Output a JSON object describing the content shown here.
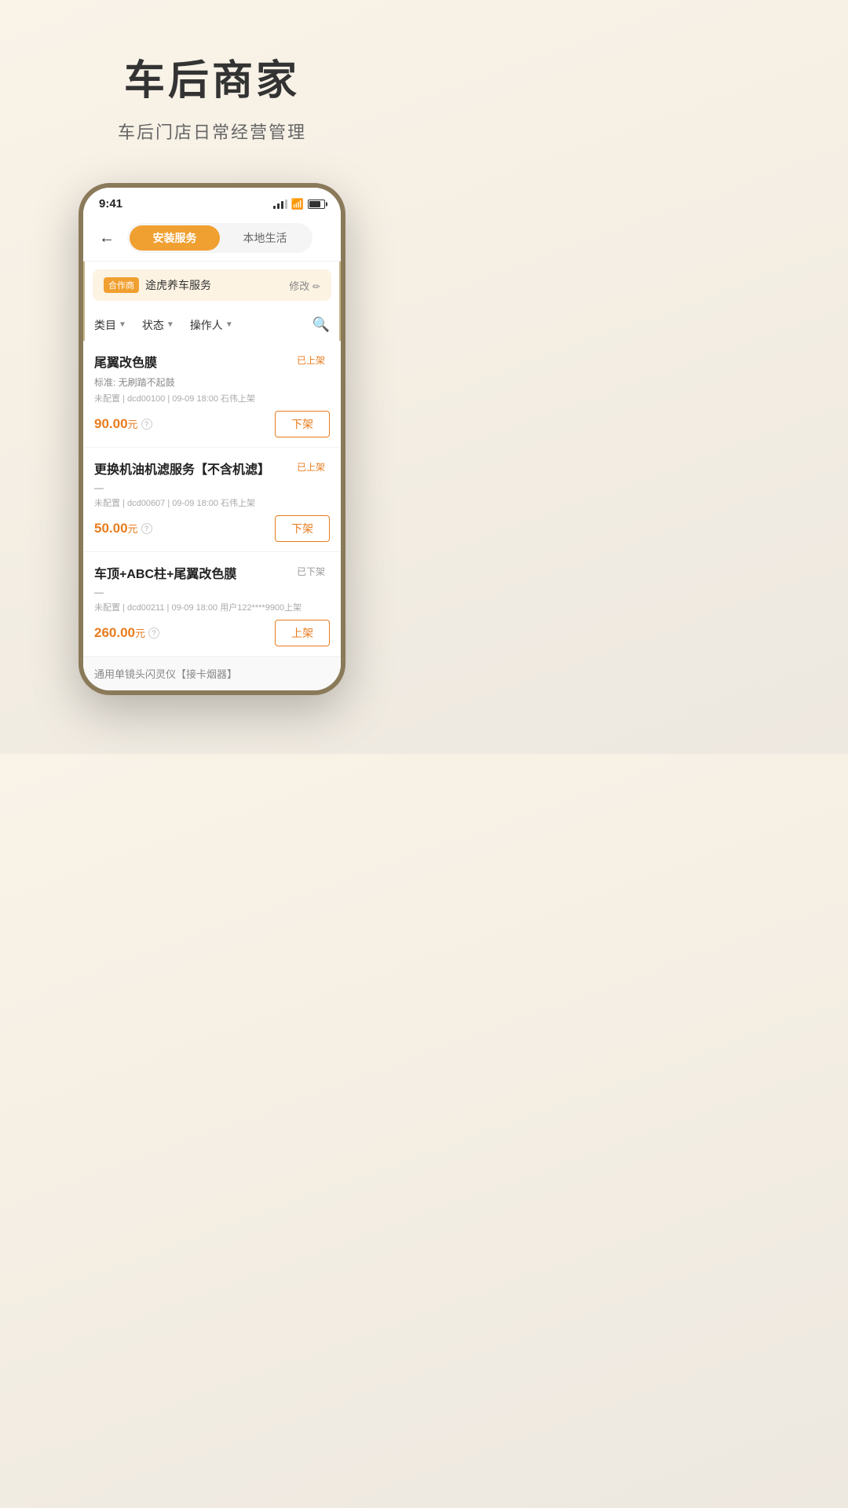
{
  "app": {
    "main_title": "车后商家",
    "sub_title": "车后门店日常经营管理"
  },
  "phone": {
    "status_bar": {
      "time": "9:41"
    },
    "nav": {
      "tab_active": "安装服务",
      "tab_inactive": "本地生活"
    },
    "partner": {
      "badge_label": "合作商",
      "name": "途虎养车服务",
      "edit_label": "修改"
    },
    "filters": {
      "category_label": "类目",
      "status_label": "状态",
      "operator_label": "操作人"
    },
    "services": [
      {
        "name": "尾翼改色膜",
        "status": "已上架",
        "status_type": "online",
        "standard": "标准: 无刷踏不起鼓",
        "meta": "未配置 | dcd00100 | 09-09 18:00 石伟上架",
        "price": "90.00",
        "price_unit": "元",
        "action": "下架"
      },
      {
        "name": "更换机油机滤服务【不含机滤】",
        "status": "已上架",
        "status_type": "online",
        "standard": "—",
        "meta": "未配置 | dcd00607 | 09-09 18:00 石伟上架",
        "price": "50.00",
        "price_unit": "元",
        "action": "下架"
      },
      {
        "name": "车顶+ABC柱+尾翼改色膜",
        "status": "已下架",
        "status_type": "offline",
        "standard": "—",
        "meta": "未配置 | dcd00211 | 09-09 18:00 用户122****9900上架",
        "price": "260.00",
        "price_unit": "元",
        "action": "上架"
      }
    ],
    "bottom_hint": "通用单镜头闪灵仪【接卡烟器】"
  }
}
